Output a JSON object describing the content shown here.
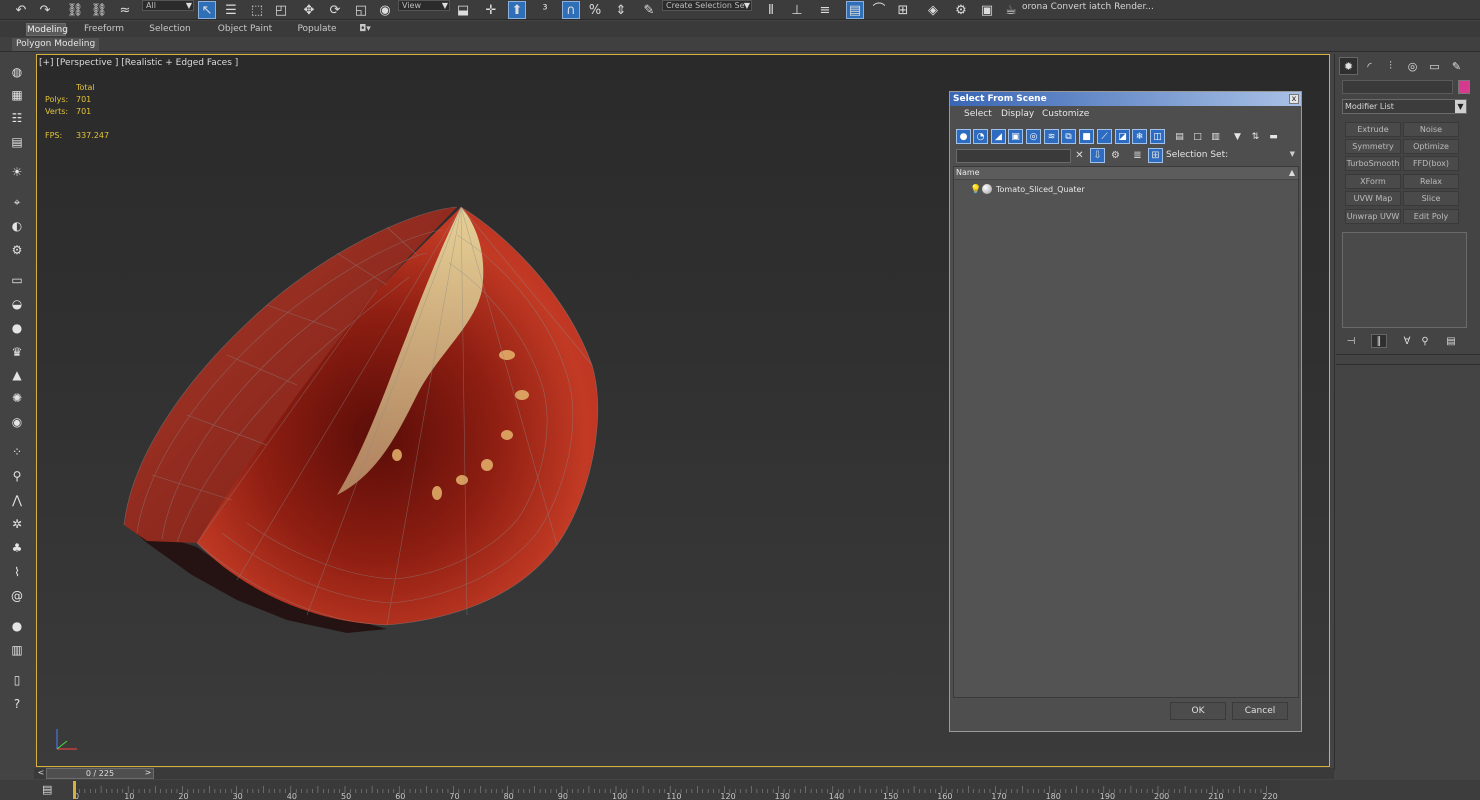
{
  "toolbar": {
    "selection_filter": "All",
    "ref_coord": "View",
    "named_selection": "Create Selection Se",
    "right_text": "orona Convert iatch Render..."
  },
  "ribbon": {
    "tabs": [
      "Modeling",
      "Freeform",
      "Selection",
      "Object Paint",
      "Populate"
    ],
    "active_tab": "Modeling",
    "sub_label": "Polygon Modeling"
  },
  "viewport": {
    "label": "[+] [Perspective ] [Realistic + Edged Faces ]",
    "stats": {
      "header": "Total",
      "polys_label": "Polys:",
      "polys_value": "701",
      "verts_label": "Verts:",
      "verts_value": "701",
      "fps_label": "FPS:",
      "fps_value": "337.247"
    },
    "border_color": "#d6b23c"
  },
  "command_panel": {
    "modifier_list_label": "Modifier List",
    "object_color": "#d63a8f",
    "modifier_buttons": [
      "Extrude",
      "Noise",
      "Symmetry",
      "Optimize",
      "TurboSmooth",
      "FFD(box)",
      "XForm",
      "Relax",
      "UVW Map",
      "Slice",
      "Unwrap UVW",
      "Edit Poly"
    ]
  },
  "dialog": {
    "title": "Select From Scene",
    "close_label": "x",
    "menu": [
      "Select",
      "Display",
      "Customize"
    ],
    "selection_set_label": "Selection Set:",
    "column_header": "Name",
    "items": [
      {
        "name": "Tomato_Sliced_Quater"
      }
    ],
    "ok_label": "OK",
    "cancel_label": "Cancel"
  },
  "timeline": {
    "frame_display": "0 / 225",
    "prev": "<",
    "next": ">",
    "ruler_ticks": [
      "0",
      "10",
      "20",
      "30",
      "40",
      "50",
      "60",
      "70",
      "80",
      "90",
      "100",
      "110",
      "120",
      "130",
      "140",
      "150",
      "160",
      "170",
      "180",
      "190",
      "200",
      "210",
      "220"
    ]
  }
}
